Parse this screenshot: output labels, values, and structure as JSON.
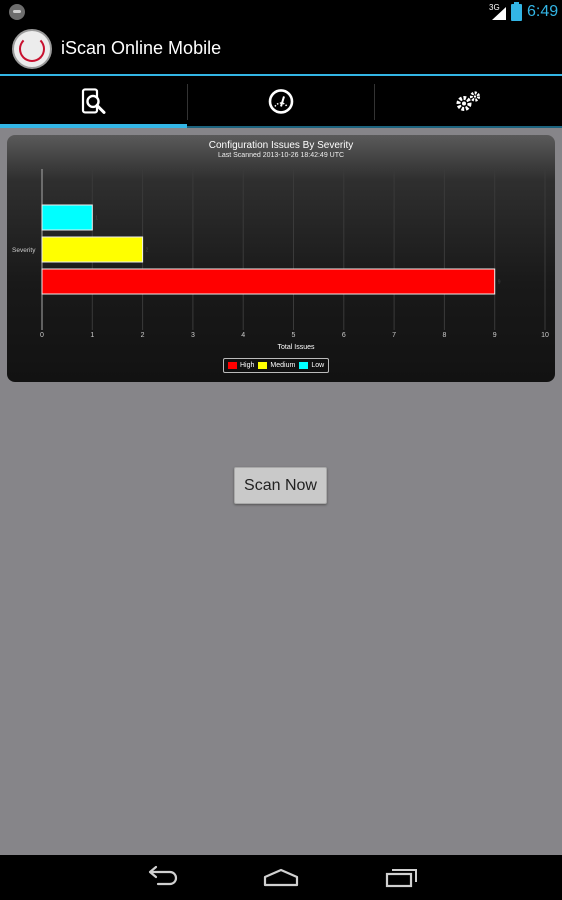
{
  "status_bar": {
    "network": "3G",
    "time": "6:49",
    "icons": [
      "notification-icon",
      "signal-icon",
      "battery-icon"
    ]
  },
  "action_bar": {
    "title": "iScan Online Mobile",
    "logo": "iscan-online-logo"
  },
  "tabs": [
    {
      "icon": "scan-device-icon",
      "selected": true
    },
    {
      "icon": "gauge-icon",
      "selected": false
    },
    {
      "icon": "settings-gears-icon",
      "selected": false
    }
  ],
  "chart_panel": {
    "title": "Configuration Issues By Severity",
    "subtitle": "Last Scanned 2013-10-26 18:42:49 UTC"
  },
  "chart_data": {
    "type": "bar",
    "orientation": "horizontal",
    "title": "Configuration Issues By Severity",
    "subtitle": "Last Scanned 2013-10-26 18:42:49 UTC",
    "xlabel": "Total Issues",
    "ylabel": "Severity",
    "xlim": [
      0,
      10
    ],
    "xticks": [
      "0",
      "1",
      "2",
      "3",
      "4",
      "5",
      "6",
      "7",
      "8",
      "9",
      "10"
    ],
    "grid": true,
    "legend_position": "bottom",
    "series": [
      {
        "name": "High",
        "values": [
          9
        ],
        "color": "#ff0000",
        "label": "9"
      },
      {
        "name": "Medium",
        "values": [
          2
        ],
        "color": "#ffff00",
        "label": "2"
      },
      {
        "name": "Low",
        "values": [
          1
        ],
        "color": "#00ffff",
        "label": "1"
      }
    ]
  },
  "scan_button": {
    "label": "Scan Now"
  },
  "nav_bar": {
    "icons": [
      "back-icon",
      "home-icon",
      "recent-apps-icon"
    ]
  },
  "colors": {
    "accent": "#33b5e5",
    "background": "#868589",
    "high": "#ff0000",
    "medium": "#ffff00",
    "low": "#00ffff"
  }
}
